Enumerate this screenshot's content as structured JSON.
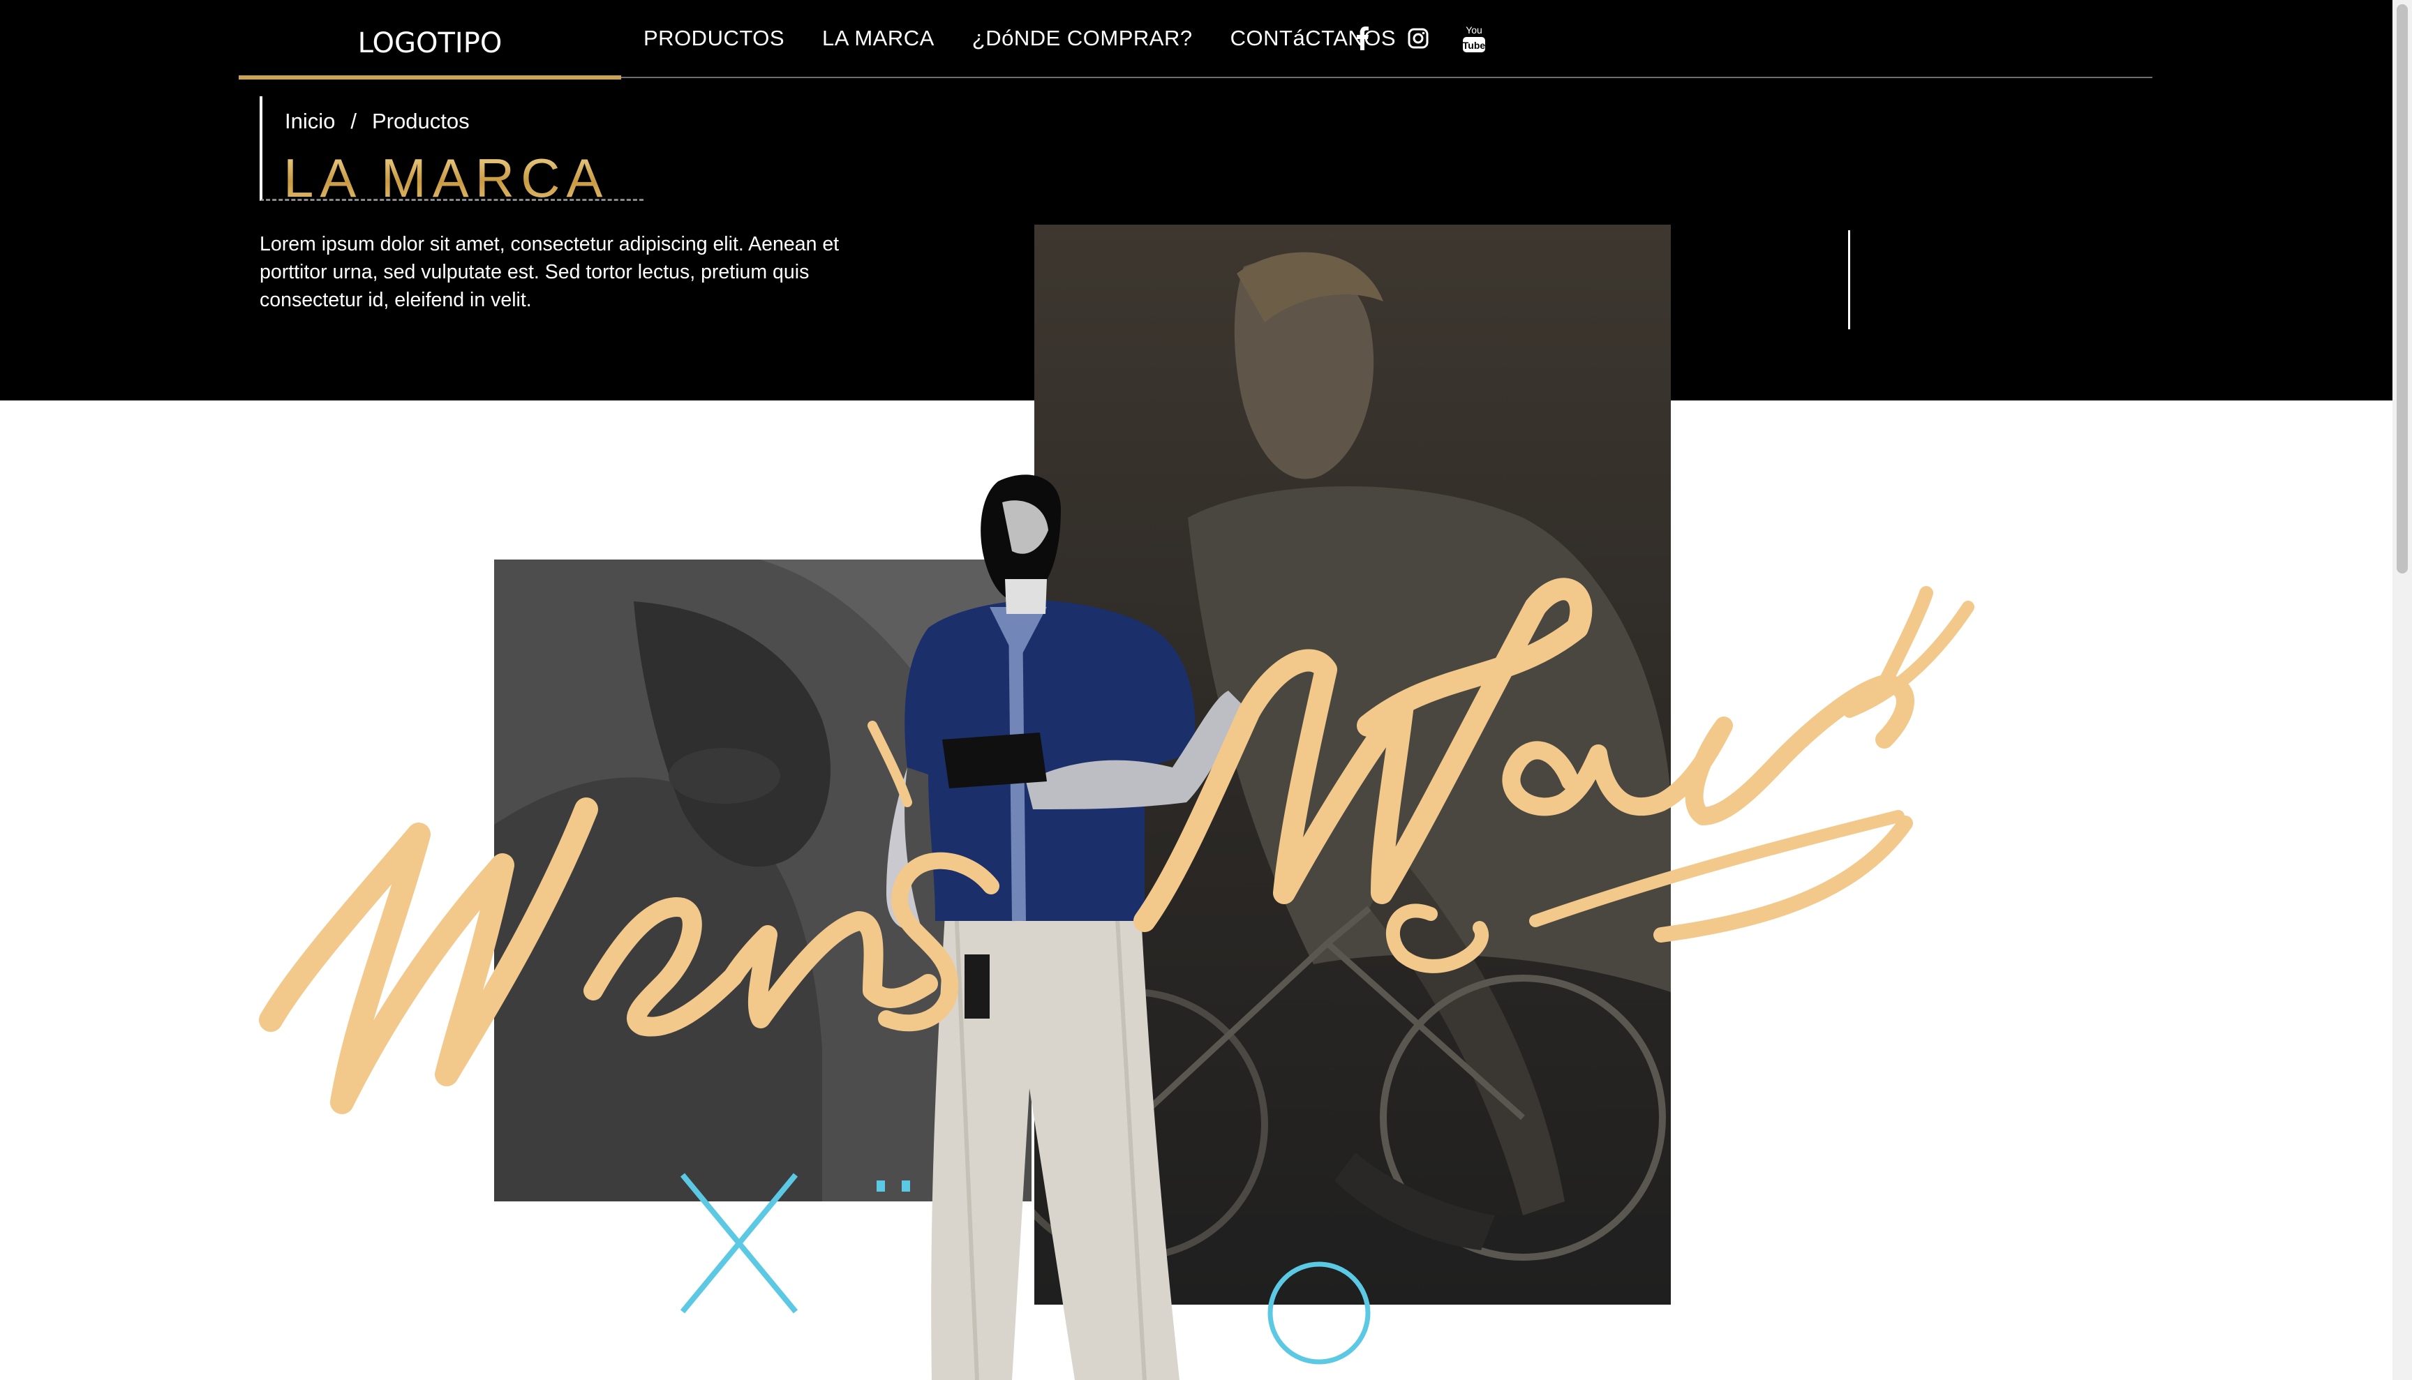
{
  "nav": {
    "logo": "LOGOTIPO",
    "menu": [
      {
        "label": "PRODUCTOS"
      },
      {
        "label": "LA MARCA"
      },
      {
        "label": "¿DóNDE COMPRAR?"
      },
      {
        "label": "CONTáCTANOS"
      }
    ],
    "social_icons": [
      "facebook-icon",
      "instagram-icon",
      "youtube-icon"
    ]
  },
  "breadcrumb": {
    "home": "Inicio",
    "separator": "/",
    "current": "Productos"
  },
  "page_title": "LA MARCA",
  "intro_text": "Lorem ipsum dolor sit amet, consectetur adipiscing elit. Aenean et porttitor urna, sed vulputate est. Sed tortor lectus, pretium quis consectetur id, eleifend in velit.",
  "hero": {
    "script_text": "MensWear",
    "script_color": "#f2c98a"
  },
  "colors": {
    "accent": "#c9a35a",
    "title_gold": "#d7b15c",
    "hero_bg": "#000000",
    "deco_cyan": "#5bc8e4"
  }
}
